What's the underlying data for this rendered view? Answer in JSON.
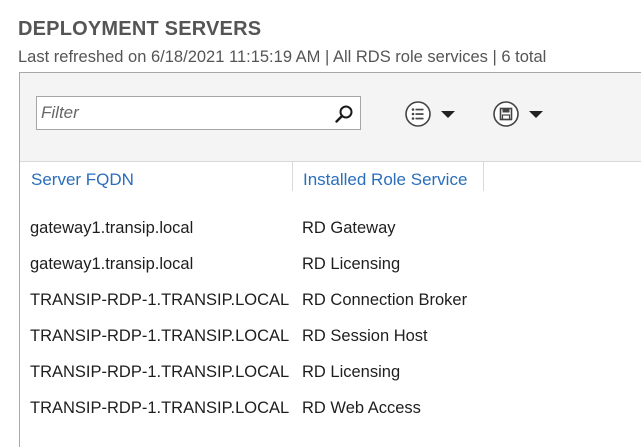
{
  "header": {
    "title": "DEPLOYMENT SERVERS",
    "subtitle": "Last refreshed on 6/18/2021 11:15:19 AM | All RDS role services  | 6 total"
  },
  "toolbar": {
    "filter_placeholder": "Filter",
    "search_icon": "search-icon",
    "view_options_icon": "list-options-icon",
    "save_icon": "save-icon"
  },
  "table": {
    "columns": [
      "Server FQDN",
      "Installed Role Service"
    ],
    "rows": [
      {
        "server": "gateway1.transip.local",
        "role": "RD Gateway"
      },
      {
        "server": "gateway1.transip.local",
        "role": "RD Licensing"
      },
      {
        "server": "TRANSIP-RDP-1.TRANSIP.LOCAL",
        "role": "RD Connection Broker"
      },
      {
        "server": "TRANSIP-RDP-1.TRANSIP.LOCAL",
        "role": "RD Session Host"
      },
      {
        "server": "TRANSIP-RDP-1.TRANSIP.LOCAL",
        "role": "RD Licensing"
      },
      {
        "server": "TRANSIP-RDP-1.TRANSIP.LOCAL",
        "role": "RD Web Access"
      }
    ]
  },
  "colors": {
    "header_link": "#2a6ebb",
    "title_gray": "#555555"
  }
}
